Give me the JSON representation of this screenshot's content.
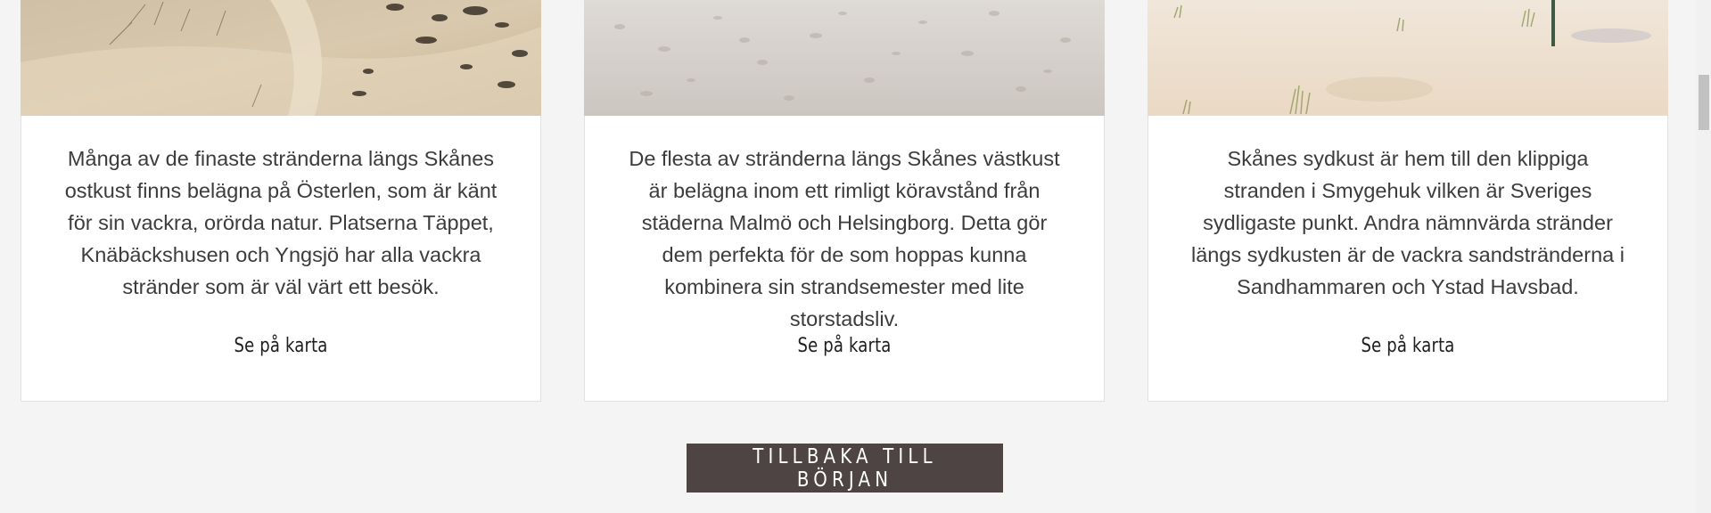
{
  "cards": [
    {
      "text": "Många av de finaste stränderna längs Skånes ostkust finns belägna på Österlen, som är känt för sin vackra, orörda natur. Platserna Täppet, Knäbäckshusen och Yngsjö har alla vackra stränder som är väl värt ett besök.",
      "link": "Se på karta"
    },
    {
      "text": "De flesta av stränderna längs Skånes västkust är belägna inom ett rimligt köravstånd från städerna Malmö och Helsingborg. Detta gör dem perfekta för de som hoppas kunna kombinera sin strandsemester med lite storstadsliv.",
      "link": "Se på karta"
    },
    {
      "text": "Skånes sydkust är hem till den klippiga stranden i Smygehuk vilken är Sveriges sydligaste punkt. Andra nämnvärda stränder längs sydkusten är de vackra sandstränderna i Sandhammaren och Ystad Havsbad.",
      "link": "Se på karta"
    }
  ],
  "back_button": {
    "label": "Tillbaka till början"
  },
  "colors": {
    "page_background": "#f4f4f4",
    "card_background": "#ffffff",
    "button_background": "#4e4443",
    "button_text": "#ffffff",
    "body_text": "#3c3c3c"
  }
}
